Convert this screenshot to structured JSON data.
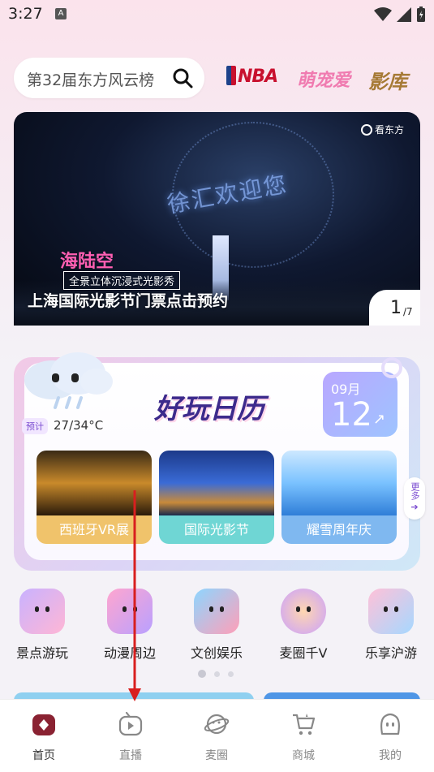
{
  "status": {
    "time": "3:27",
    "notif_letter": "A"
  },
  "search": {
    "placeholder_text": "第32届东方风云榜"
  },
  "brands": [
    "NBA",
    "萌宠爱",
    "影库"
  ],
  "banner": {
    "watermark": "看东方",
    "sky_text": "徐汇欢迎您",
    "tag_title": "海陆空",
    "tag_sub": "全景立体沉浸式光影秀",
    "caption": "上海国际光影节门票点击预约",
    "page_current": "1",
    "page_total": "/7"
  },
  "calendar": {
    "title": "好玩日历",
    "weather_tag": "预计",
    "weather_value": "27/34°C",
    "month": "09月",
    "day": "12",
    "more_label": "更多",
    "cards": [
      {
        "label": "西班牙VR展"
      },
      {
        "label": "国际光影节"
      },
      {
        "label": "耀雪周年庆"
      }
    ]
  },
  "categories": [
    {
      "label": "景点游玩",
      "icon": "attraction-icon"
    },
    {
      "label": "动漫周边",
      "icon": "anime-icon"
    },
    {
      "label": "文创娱乐",
      "icon": "culture-icon"
    },
    {
      "label": "麦圈千V",
      "icon": "planet-icon"
    },
    {
      "label": "乐享沪游",
      "icon": "plane-icon"
    }
  ],
  "nav": [
    {
      "label": "首页",
      "icon": "home-icon",
      "active": true
    },
    {
      "label": "直播",
      "icon": "live-tv-icon",
      "active": false
    },
    {
      "label": "麦圈",
      "icon": "planet-icon",
      "active": false
    },
    {
      "label": "商城",
      "icon": "shop-icon",
      "active": false
    },
    {
      "label": "我的",
      "icon": "profile-icon",
      "active": false
    }
  ],
  "colors": {
    "accent": "#3c2a8c",
    "pink": "#ff5fb2",
    "annotation_arrow": "#d81f1f"
  }
}
